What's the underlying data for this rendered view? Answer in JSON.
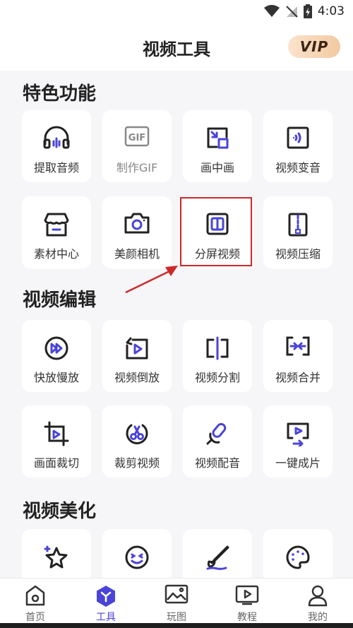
{
  "status": {
    "time": "4:03"
  },
  "header": {
    "title": "视频工具",
    "vip_label": "VIP"
  },
  "colors": {
    "accent": "#4a44d8",
    "highlight": "#cc2a2a",
    "vip_from": "#fbe3cc",
    "vip_to": "#f2c9a1"
  },
  "sections": [
    {
      "title": "特色功能"
    },
    {
      "title": "视频编辑"
    },
    {
      "title": "视频美化"
    }
  ],
  "cards": [
    {
      "label": "提取音频",
      "icon": "headphones-icon"
    },
    {
      "label": "制作GIF",
      "icon": "gif-icon"
    },
    {
      "label": "画中画",
      "icon": "picture-in-picture-icon"
    },
    {
      "label": "视频变音",
      "icon": "voice-change-icon"
    },
    {
      "label": "素材中心",
      "icon": "store-icon"
    },
    {
      "label": "美颜相机",
      "icon": "camera-icon"
    },
    {
      "label": "分屏视频",
      "icon": "split-screen-icon"
    },
    {
      "label": "视频压缩",
      "icon": "compress-icon"
    },
    {
      "label": "快放慢放",
      "icon": "fast-forward-icon"
    },
    {
      "label": "视频倒放",
      "icon": "reverse-play-icon"
    },
    {
      "label": "视频分割",
      "icon": "split-icon"
    },
    {
      "label": "视频合并",
      "icon": "merge-icon"
    },
    {
      "label": "画面裁切",
      "icon": "crop-icon"
    },
    {
      "label": "裁剪视频",
      "icon": "scissors-icon"
    },
    {
      "label": "视频配音",
      "icon": "microphone-icon"
    },
    {
      "label": "一键成片",
      "icon": "one-click-video-icon"
    },
    {
      "label": "",
      "icon": "sparkle-star-icon"
    },
    {
      "label": "",
      "icon": "emoji-icon"
    },
    {
      "label": "",
      "icon": "brush-icon"
    },
    {
      "label": "",
      "icon": "palette-icon"
    }
  ],
  "tabs": [
    {
      "label": "首页",
      "icon": "home-icon",
      "active": false
    },
    {
      "label": "工具",
      "icon": "tools-icon",
      "active": true
    },
    {
      "label": "玩图",
      "icon": "image-icon",
      "active": false
    },
    {
      "label": "教程",
      "icon": "tutorial-play-icon",
      "active": false
    },
    {
      "label": "我的",
      "icon": "profile-icon",
      "active": false
    }
  ]
}
